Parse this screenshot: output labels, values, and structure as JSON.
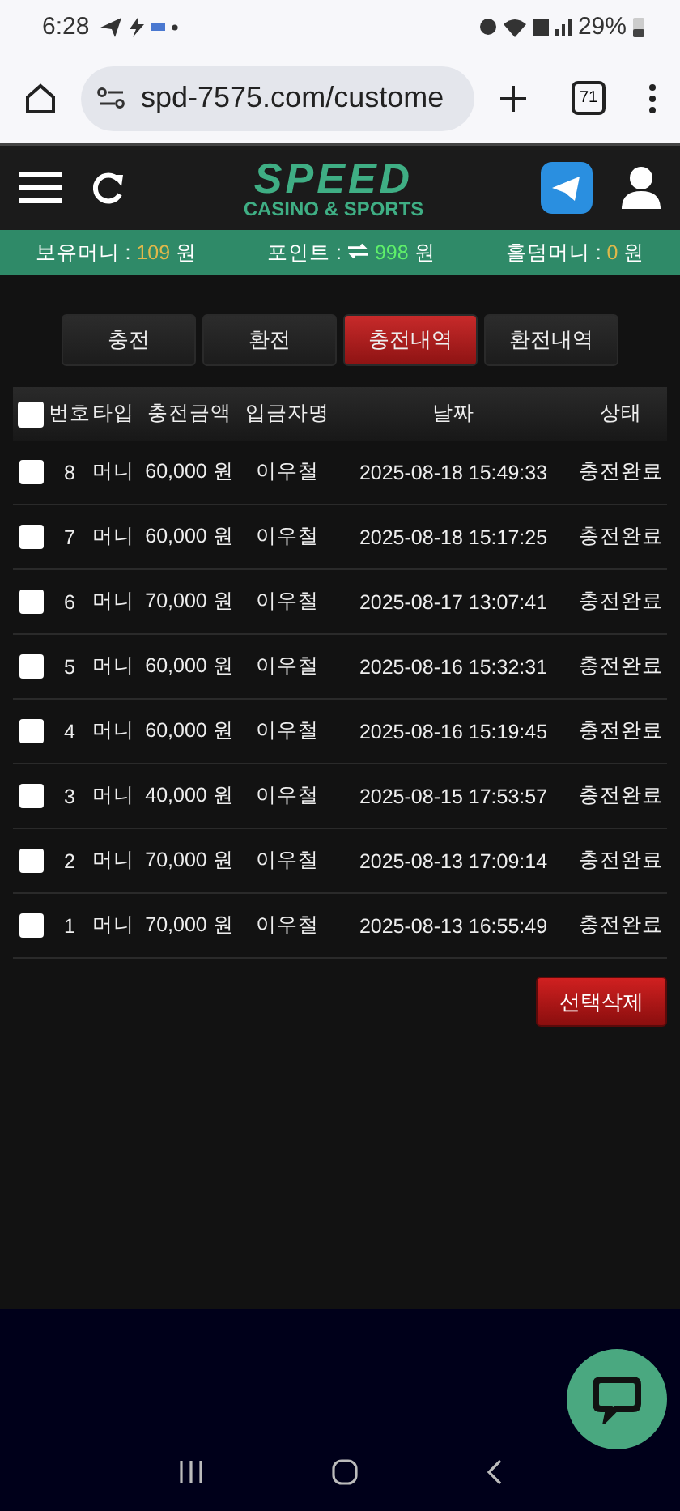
{
  "status_bar": {
    "time": "6:28",
    "battery": "29%"
  },
  "browser": {
    "url": "spd-7575.com/custome",
    "tab_count": "71"
  },
  "header": {
    "logo": "SPEED",
    "logo_sub": "CASINO & SPORTS"
  },
  "info_bar": [
    {
      "label": "보유머니 :",
      "value": "109",
      "unit": "원",
      "color": "#e0b84a"
    },
    {
      "label": "포인트 :",
      "value": "998",
      "unit": "원",
      "color": "#5ff06a",
      "transfer": true
    },
    {
      "label": "홀덤머니 :",
      "value": "0",
      "unit": "원",
      "color": "#e0b84a"
    }
  ],
  "tabs": [
    {
      "label": "충전",
      "selected": false
    },
    {
      "label": "환전",
      "selected": false
    },
    {
      "label": "충전내역",
      "selected": true
    },
    {
      "label": "환전내역",
      "selected": false
    }
  ],
  "table": {
    "select_all_checked": false,
    "columns": [
      "번호",
      "타입",
      "충전금액",
      "입금자명",
      "날짜",
      "상태"
    ],
    "rows": [
      {
        "checked": false,
        "cells": [
          "8",
          "머니",
          "60,000 원",
          "이우철",
          "2025-08-18 15:49:33",
          "충전완료"
        ]
      },
      {
        "checked": false,
        "cells": [
          "7",
          "머니",
          "60,000 원",
          "이우철",
          "2025-08-18 15:17:25",
          "충전완료"
        ]
      },
      {
        "checked": false,
        "cells": [
          "6",
          "머니",
          "70,000 원",
          "이우철",
          "2025-08-17 13:07:41",
          "충전완료"
        ]
      },
      {
        "checked": false,
        "cells": [
          "5",
          "머니",
          "60,000 원",
          "이우철",
          "2025-08-16 15:32:31",
          "충전완료"
        ]
      },
      {
        "checked": false,
        "cells": [
          "4",
          "머니",
          "60,000 원",
          "이우철",
          "2025-08-16 15:19:45",
          "충전완료"
        ]
      },
      {
        "checked": false,
        "cells": [
          "3",
          "머니",
          "40,000 원",
          "이우철",
          "2025-08-15 17:53:57",
          "충전완료"
        ]
      },
      {
        "checked": false,
        "cells": [
          "2",
          "머니",
          "70,000 원",
          "이우철",
          "2025-08-13 17:09:14",
          "충전완료"
        ]
      },
      {
        "checked": false,
        "cells": [
          "1",
          "머니",
          "70,000 원",
          "이우철",
          "2025-08-13 16:55:49",
          "충전완료"
        ]
      }
    ]
  },
  "delete_button": "선택삭제"
}
